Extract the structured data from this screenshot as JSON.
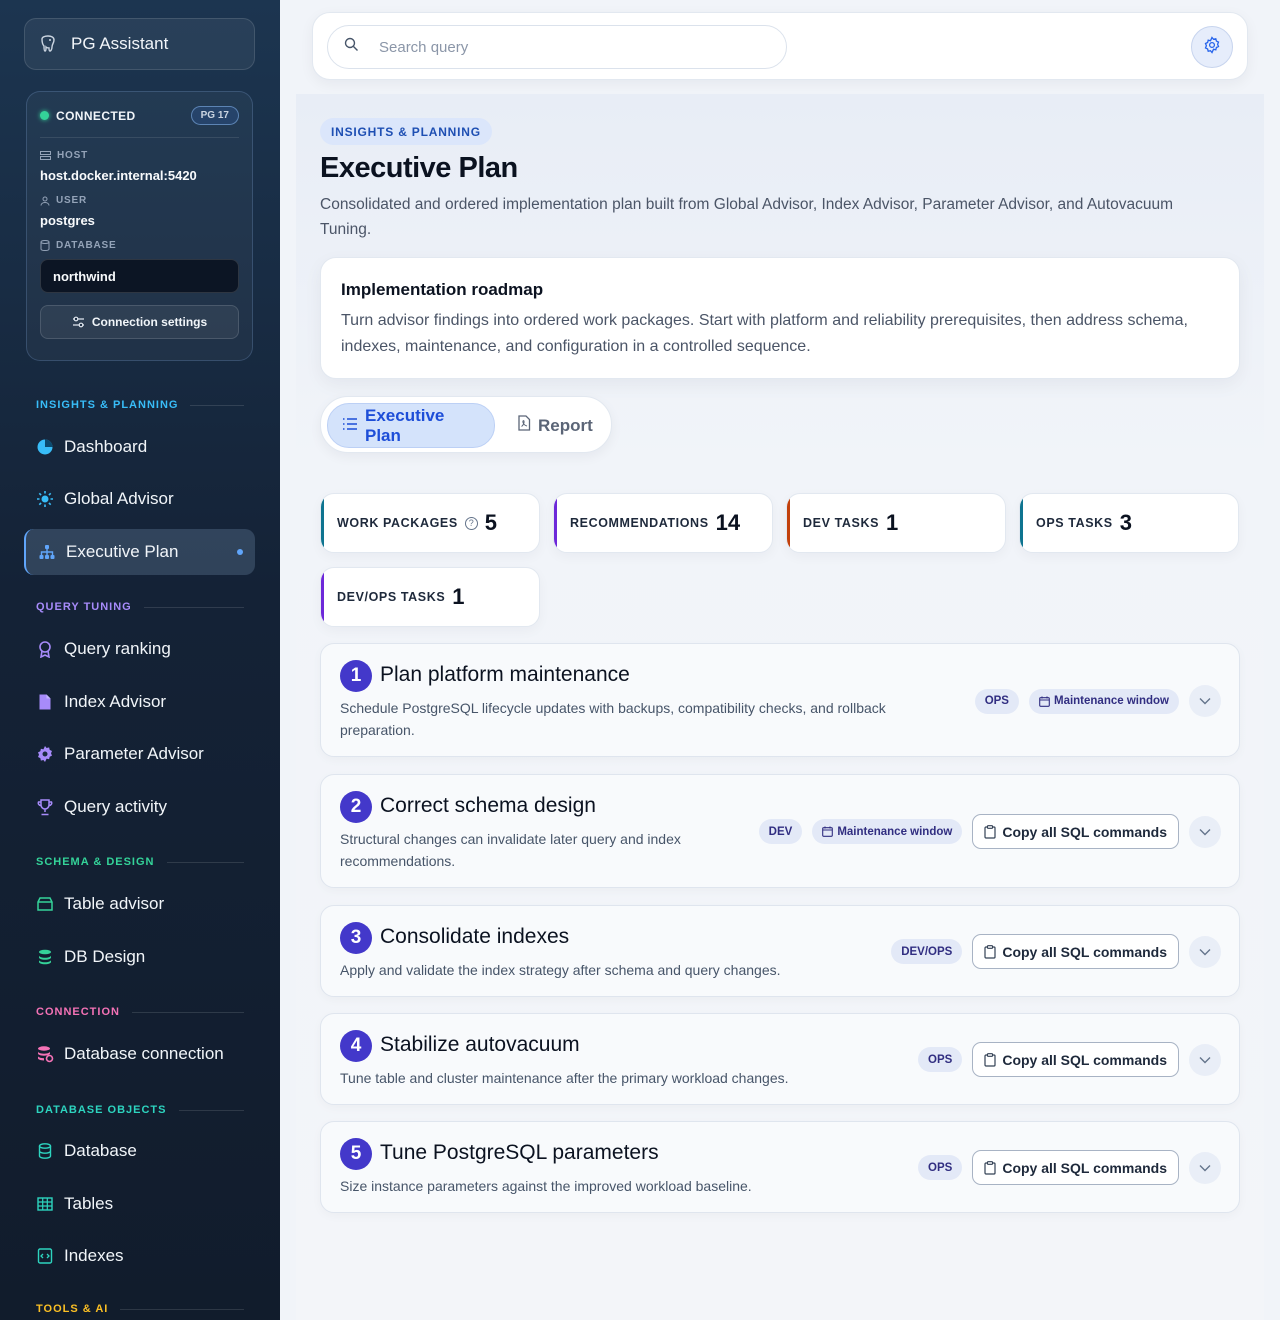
{
  "app": {
    "title": "PG Assistant"
  },
  "connection": {
    "status": "CONNECTED",
    "version_badge": "PG 17",
    "host_label": "HOST",
    "host": "host.docker.internal:5420",
    "user_label": "USER",
    "user": "postgres",
    "database_label": "DATABASE",
    "database": "northwind",
    "settings_label": "Connection settings"
  },
  "nav": {
    "sections": [
      {
        "id": "insights",
        "label": "INSIGHTS & PLANNING",
        "color": "#38bdf8"
      },
      {
        "id": "query",
        "label": "QUERY TUNING",
        "color": "#a78bfa"
      },
      {
        "id": "schema",
        "label": "SCHEMA & DESIGN",
        "color": "#34d399"
      },
      {
        "id": "connection",
        "label": "CONNECTION",
        "color": "#f472b6"
      },
      {
        "id": "dbobjects",
        "label": "DATABASE OBJECTS",
        "color": "#2dd4bf"
      },
      {
        "id": "tools",
        "label": "TOOLS & AI",
        "color": "#fbbf24"
      }
    ],
    "items": [
      {
        "label": "Dashboard",
        "icon": "pie-chart-icon"
      },
      {
        "label": "Global Advisor",
        "icon": "sun-icon"
      },
      {
        "label": "Executive Plan",
        "icon": "hierarchy-icon",
        "active": true
      },
      {
        "label": "Query ranking",
        "icon": "award-icon"
      },
      {
        "label": "Index Advisor",
        "icon": "file-icon"
      },
      {
        "label": "Parameter Advisor",
        "icon": "cog-icon"
      },
      {
        "label": "Query activity",
        "icon": "trophy-icon"
      },
      {
        "label": "Table advisor",
        "icon": "table-advisor-icon"
      },
      {
        "label": "DB Design",
        "icon": "db-stack-icon"
      },
      {
        "label": "Database connection",
        "icon": "database-settings-icon"
      },
      {
        "label": "Database",
        "icon": "database-icon"
      },
      {
        "label": "Tables",
        "icon": "grid-icon"
      },
      {
        "label": "Indexes",
        "icon": "code-file-icon"
      }
    ]
  },
  "search": {
    "placeholder": "Search query"
  },
  "page": {
    "eyebrow": "INSIGHTS & PLANNING",
    "title": "Executive Plan",
    "description": "Consolidated and ordered implementation plan built from Global Advisor, Index Advisor, Parameter Advisor, and Autovacuum Tuning."
  },
  "roadmap": {
    "title": "Implementation roadmap",
    "text": "Turn advisor findings into ordered work packages. Start with platform and reliability prerequisites, then address schema, indexes, maintenance, and configuration in a controlled sequence."
  },
  "tabs": [
    {
      "label": "Executive Plan",
      "icon": "list-icon",
      "active": true
    },
    {
      "label": "Report",
      "icon": "pdf-icon",
      "active": false
    }
  ],
  "stats": [
    {
      "label": "WORK PACKAGES",
      "value": "5",
      "color": "#0e7490",
      "help": "?"
    },
    {
      "label": "RECOMMENDATIONS",
      "value": "14",
      "color": "#6d28d9"
    },
    {
      "label": "DEV TASKS",
      "value": "1",
      "color": "#c2410c"
    },
    {
      "label": "OPS TASKS",
      "value": "3",
      "color": "#0e7490"
    },
    {
      "label": "DEV/OPS TASKS",
      "value": "1",
      "color": "#6d28d9"
    }
  ],
  "packages": [
    {
      "num": "1",
      "title": "Plan platform maintenance",
      "desc": "Schedule PostgreSQL lifecycle updates with backups, compatibility checks, and rollback preparation.",
      "tag": "OPS",
      "window": "Maintenance window",
      "copy": ""
    },
    {
      "num": "2",
      "title": "Correct schema design",
      "desc": "Structural changes can invalidate later query and index recommendations.",
      "tag": "DEV",
      "window": "Maintenance window",
      "copy": "Copy all SQL commands"
    },
    {
      "num": "3",
      "title": "Consolidate indexes",
      "desc": "Apply and validate the index strategy after schema and query changes.",
      "tag": "DEV/OPS",
      "window": "",
      "copy": "Copy all SQL commands"
    },
    {
      "num": "4",
      "title": "Stabilize autovacuum",
      "desc": "Tune table and cluster maintenance after the primary workload changes.",
      "tag": "OPS",
      "window": "",
      "copy": "Copy all SQL commands"
    },
    {
      "num": "5",
      "title": "Tune PostgreSQL parameters",
      "desc": "Size instance parameters against the improved workload baseline.",
      "tag": "OPS",
      "window": "",
      "copy": "Copy all SQL commands"
    }
  ]
}
